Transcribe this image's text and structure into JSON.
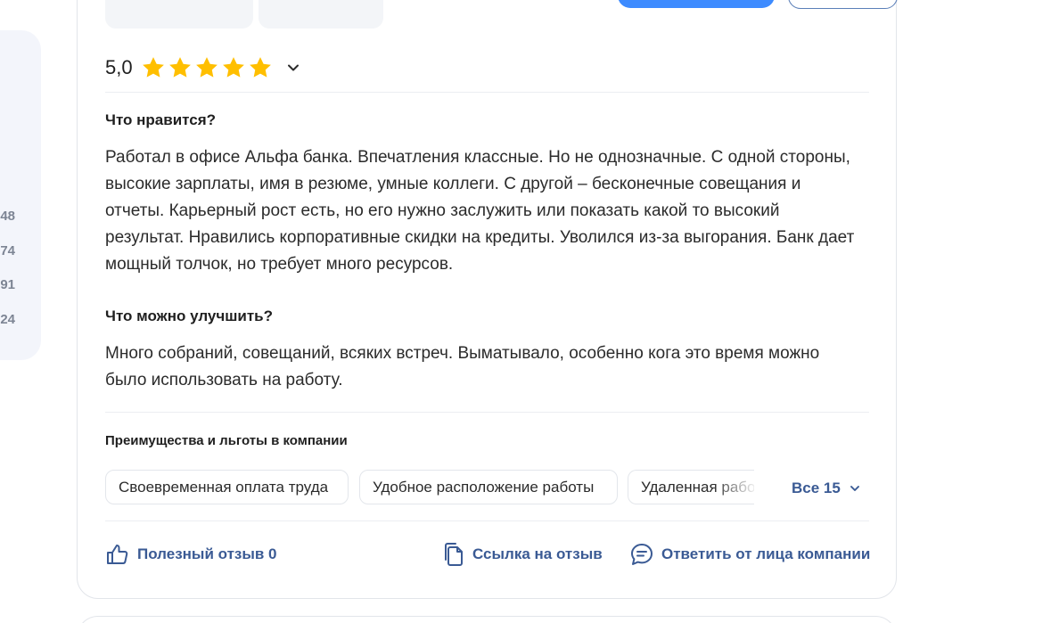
{
  "sidebar": {
    "counts": [
      "48",
      "74",
      "91",
      "24"
    ]
  },
  "review": {
    "rating": "5,0",
    "stars": 5,
    "likes": {
      "title": "Что нравится?",
      "text": "Работал в офисе Альфа банка. Впечатления классные. Но не однозначные. С одной стороны, высокие зарплаты, имя в резюме, умные коллеги. С другой – бесконечные совещания и отчеты. Карьерный рост есть, но его нужно заслужить или показать какой то высокий результат. Нравились корпоративные скидки на кредиты. Уволился из-за выгорания. Банк дает мощный толчок, но требует много ресурсов."
    },
    "improve": {
      "title": "Что можно улучшить?",
      "text": "Много собраний, совещаний, всяких встреч. Выматывало, особенно кога это время можно было использовать на работу."
    },
    "benefits": {
      "title": "Преимущества и льготы в компании",
      "tags": [
        "Своевременная оплата труда",
        "Удобное расположение работы",
        "Удаленная работа"
      ],
      "all_label": "Все 15"
    },
    "actions": {
      "useful": "Полезный отзыв 0",
      "link": "Ссылка на отзыв",
      "reply": "Ответить от лица компании"
    }
  },
  "colors": {
    "star": "#ffbf00",
    "link": "#3a5a94",
    "primary": "#3d8bff"
  }
}
